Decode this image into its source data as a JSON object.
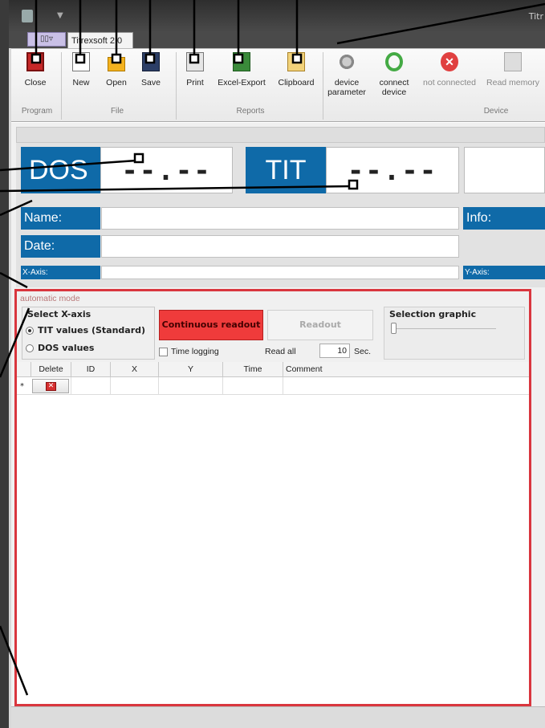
{
  "window": {
    "title": "Titr",
    "app_tab_label": "",
    "file_tab": "Titrexsoft 2.0"
  },
  "ribbon": {
    "program": {
      "label": "Program",
      "buttons": [
        {
          "label": "Close",
          "icon": "close-icon"
        }
      ]
    },
    "file": {
      "label": "File",
      "buttons": [
        {
          "label": "New",
          "icon": "new-icon"
        },
        {
          "label": "Open",
          "icon": "open-icon"
        },
        {
          "label": "Save",
          "icon": "save-icon"
        }
      ]
    },
    "reports": {
      "label": "Reports",
      "buttons": [
        {
          "label": "Print",
          "icon": "print-icon"
        },
        {
          "label": "Excel-Export",
          "icon": "excel-icon"
        },
        {
          "label": "Clipboard",
          "icon": "clipboard-icon"
        }
      ]
    },
    "device": {
      "label": "Device",
      "buttons": [
        {
          "line1": "device",
          "line2": "parameter",
          "icon": "gear-icon"
        },
        {
          "line1": "connect",
          "line2": "device",
          "icon": "sync-icon"
        },
        {
          "line1": "not connected",
          "line2": "",
          "icon": "error-icon"
        },
        {
          "line1": "Read memory",
          "line2": "",
          "icon": "memory-icon"
        }
      ]
    }
  },
  "display": {
    "dos_label": "DOS",
    "dos_value": "--.--",
    "tit_label": "TIT",
    "tit_value": "--.--",
    "name_label": "Name:",
    "info_label": "Info:",
    "date_label": "Date:",
    "xaxis_label": "X-Axis:",
    "yaxis_label": "Y-Axis:"
  },
  "auto": {
    "title": "automatic mode",
    "select_x_axis": "Select X-axis",
    "option_tit": "TIT values (Standard)",
    "option_dos": "DOS values",
    "selected": "TIT values (Standard)",
    "continuous_readout": "Continuous readout",
    "readout": "Readout",
    "time_logging": "Time logging",
    "read_all": "Read all",
    "seconds_value": "10",
    "seconds_unit": "Sec.",
    "selection_graphic": "Selection graphic"
  },
  "grid": {
    "columns": [
      "Delete",
      "ID",
      "X",
      "Y",
      "Time",
      "Comment"
    ],
    "new_row_marker": "*"
  },
  "colors": {
    "accent_blue": "#0f6aa8",
    "alert_red": "#d9363e",
    "continuous_btn": "#ef3b3b"
  }
}
